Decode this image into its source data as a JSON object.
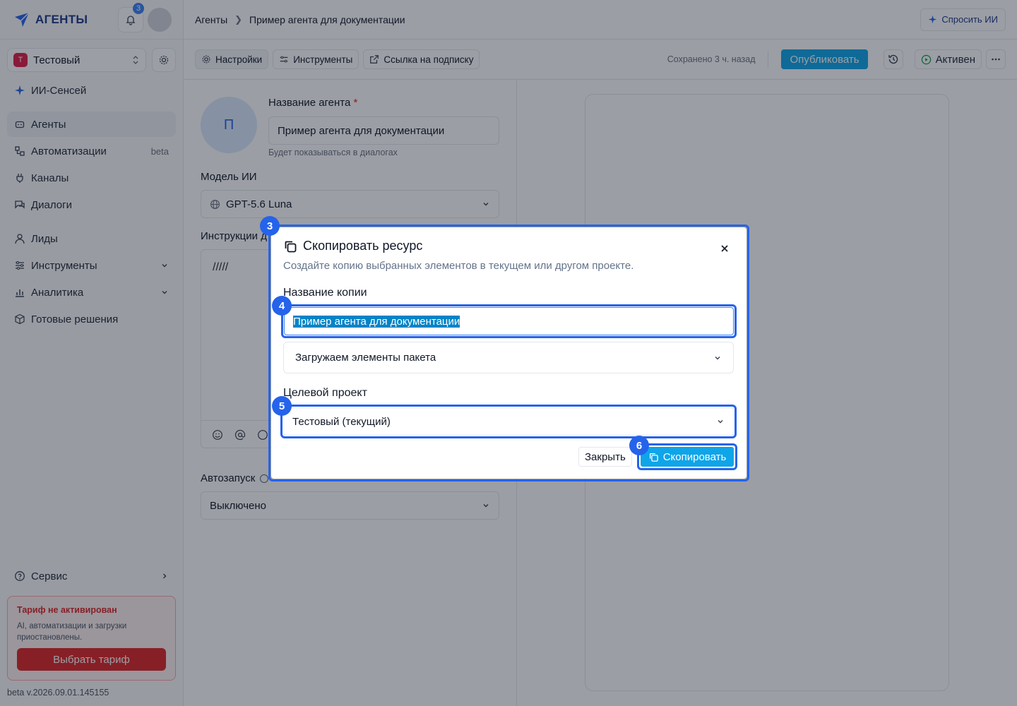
{
  "header": {
    "logo_text": "АГЕНТЫ",
    "notif_count": "3",
    "breadcrumbs": [
      "Агенты",
      "Пример агента для документации"
    ],
    "ask_ai": "Спросить ИИ"
  },
  "sidebar": {
    "project_badge": "Т",
    "project_name": "Тестовый",
    "ai_item": "ИИ-Сенсей",
    "items": [
      {
        "label": "Агенты"
      },
      {
        "label": "Автоматизации",
        "tag": "beta"
      },
      {
        "label": "Каналы"
      },
      {
        "label": "Диалоги"
      },
      {
        "label": "Лиды"
      },
      {
        "label": "Инструменты"
      },
      {
        "label": "Аналитика"
      },
      {
        "label": "Готовые решения"
      }
    ],
    "service": "Сервис",
    "tariff_title": "Тариф не активирован",
    "tariff_text": "AI, автоматизации и загрузки приостановлены.",
    "tariff_button": "Выбрать тариф",
    "version": "beta v.2026.09.01.145155"
  },
  "toolbar": {
    "settings": "Настройки",
    "tools": "Инструменты",
    "sub_link": "Ссылка на подписку",
    "saved": "Сохранено 3 ч. назад",
    "publish": "Опубликовать",
    "status": "Активен"
  },
  "form": {
    "avatar_letter": "П",
    "name_label": "Название агента",
    "required_mark": "*",
    "name_value": "Пример агента для документации",
    "name_hint": "Будет показываться в диалогах",
    "model_label": "Модель ИИ",
    "model_value": "GPT-5.6 Luna",
    "instr_label": "Инструкции д",
    "instr_text": "/////",
    "autostart_label": "Автозапуск",
    "autostart_value": "Выключено"
  },
  "modal": {
    "title": "Скопировать ресурс",
    "subtitle": "Создайте копию выбранных элементов в текущем или другом проекте.",
    "copy_name_label": "Название копии",
    "copy_name_value": "Пример агента для документации",
    "package_placeholder": "Загружаем элементы пакета",
    "target_label": "Целевой проект",
    "target_value": "Тестовый (текущий)",
    "close": "Закрыть",
    "copy": "Скопировать"
  },
  "markers": [
    "3",
    "4",
    "5",
    "6"
  ],
  "colors": {
    "accent": "#0ea5e9",
    "highlight": "#2563eb",
    "danger": "#dc2626"
  }
}
